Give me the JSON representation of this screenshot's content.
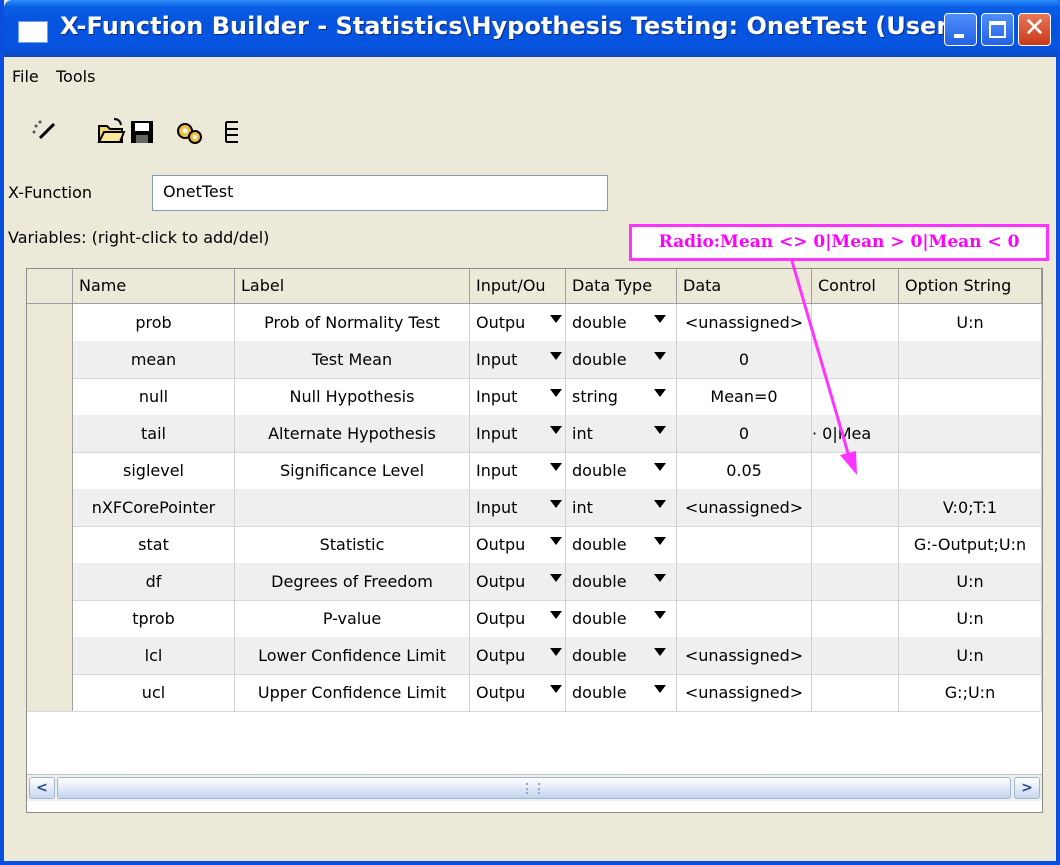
{
  "window": {
    "title": "X-Function Builder - Statistics\\Hypothesis Testing: OnetTest (User)",
    "title_color": "#0553de"
  },
  "menu": [
    "File",
    "Tools"
  ],
  "toolbar": [
    "new-icon",
    "open-icon",
    "save-icon",
    "compile-icon",
    "tree-icon"
  ],
  "xfunction": {
    "label": "X-Function",
    "value": "OnetTest"
  },
  "variables_label": "Variables: (right-click to add/del)",
  "callout": {
    "text": "Radio:Mean <> 0|Mean > 0|Mean < 0",
    "color": "#ff00ff"
  },
  "table": {
    "columns": [
      "Name",
      "Label",
      "Input/Ou",
      "Data Type",
      "Data",
      "Control",
      "Option String"
    ],
    "rows": [
      {
        "name": "prob",
        "label": "Prob of Normality Test",
        "io": "Outpu",
        "type": "double",
        "data": "<unassigned>",
        "control": "",
        "option": "U:n"
      },
      {
        "name": "mean",
        "label": "Test Mean",
        "io": "Input",
        "type": "double",
        "data": "0",
        "control": "",
        "option": ""
      },
      {
        "name": "null",
        "label": "Null Hypothesis",
        "io": "Input",
        "type": "string",
        "data": "Mean=0",
        "control": "",
        "option": ""
      },
      {
        "name": "tail",
        "label": "Alternate Hypothesis",
        "io": "Input",
        "type": "int",
        "data": "0",
        "control": "· 0|Mea",
        "option": ""
      },
      {
        "name": "siglevel",
        "label": "Significance Level",
        "io": "Input",
        "type": "double",
        "data": "0.05",
        "control": "",
        "option": ""
      },
      {
        "name": "nXFCorePointer",
        "label": "",
        "io": "Input",
        "type": "int",
        "data": "<unassigned>",
        "control": "",
        "option": "V:0;T:1"
      },
      {
        "name": "stat",
        "label": "Statistic",
        "io": "Outpu",
        "type": "double",
        "data": "",
        "control": "",
        "option": "G:-Output;U:n"
      },
      {
        "name": "df",
        "label": "Degrees of Freedom",
        "io": "Outpu",
        "type": "double",
        "data": "",
        "control": "",
        "option": "U:n"
      },
      {
        "name": "tprob",
        "label": "P-value",
        "io": "Outpu",
        "type": "double",
        "data": "",
        "control": "",
        "option": "U:n"
      },
      {
        "name": "lcl",
        "label": "Lower Confidence Limit",
        "io": "Outpu",
        "type": "double",
        "data": "<unassigned>",
        "control": "",
        "option": "U:n"
      },
      {
        "name": "ucl",
        "label": "Upper Confidence Limit",
        "io": "Outpu",
        "type": "double",
        "data": "<unassigned>",
        "control": "",
        "option": "G:;U:n"
      }
    ]
  }
}
